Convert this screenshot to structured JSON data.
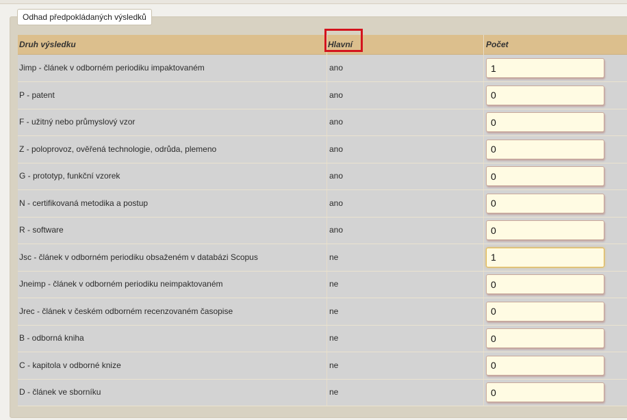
{
  "section": {
    "legend": "Odhad předpokládaných výsledků"
  },
  "table": {
    "headers": {
      "type": "Druh výsledku",
      "main": "Hlavní",
      "count": "Počet"
    },
    "rows": [
      {
        "type": "Jimp - článek v odborném periodiku impaktovaném",
        "main": "ano",
        "count": "1"
      },
      {
        "type": "P - patent",
        "main": "ano",
        "count": "0"
      },
      {
        "type": "F - užitný nebo průmyslový vzor",
        "main": "ano",
        "count": "0"
      },
      {
        "type": "Z - poloprovoz, ověřená technologie, odrůda, plemeno",
        "main": "ano",
        "count": "0"
      },
      {
        "type": "G - prototyp, funkční vzorek",
        "main": "ano",
        "count": "0"
      },
      {
        "type": "N - certifikovaná metodika a postup",
        "main": "ano",
        "count": "0"
      },
      {
        "type": "R - software",
        "main": "ano",
        "count": "0"
      },
      {
        "type": "Jsc - článek v odborném periodiku obsaženém v databázi Scopus",
        "main": "ne",
        "count": "1"
      },
      {
        "type": "Jneimp - článek v odborném periodiku neimpaktovaném",
        "main": "ne",
        "count": "0"
      },
      {
        "type": "Jrec - článek v českém odborném recenzovaném časopise",
        "main": "ne",
        "count": "0"
      },
      {
        "type": "B - odborná kniha",
        "main": "ne",
        "count": "0"
      },
      {
        "type": "C - kapitola v odborné knize",
        "main": "ne",
        "count": "0"
      },
      {
        "type": "D - článek ve sborníku",
        "main": "ne",
        "count": "0"
      }
    ]
  },
  "colors": {
    "header_bg": "#dcbf8d",
    "row_bg": "#d3d3d3",
    "input_bg": "#fffbe3",
    "highlight": "#d3141d"
  }
}
